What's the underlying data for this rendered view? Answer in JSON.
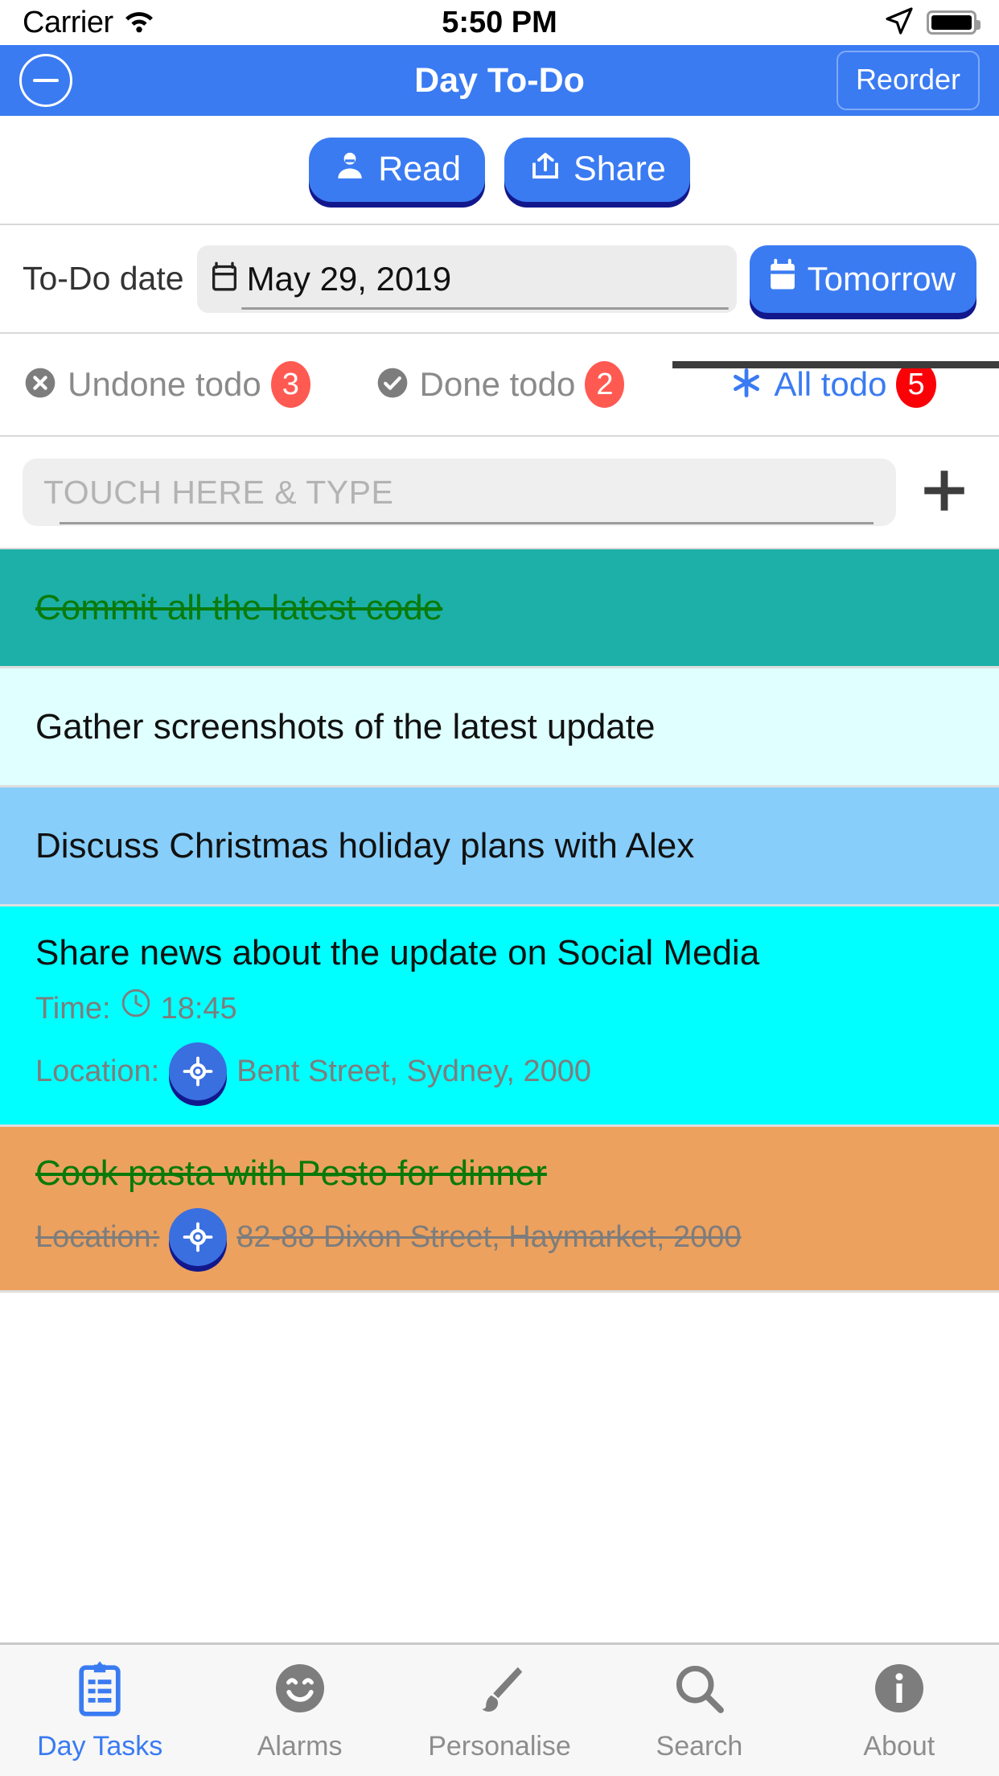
{
  "status_bar": {
    "carrier": "Carrier",
    "wifi_icon": "wifi-icon",
    "time": "5:50 PM",
    "location_icon": "location-arrow-icon",
    "battery_icon": "battery-full-icon"
  },
  "nav_bar": {
    "minus_icon": "minus-circle-icon",
    "title": "Day To-Do",
    "reorder_label": "Reorder"
  },
  "actions": {
    "read_label": "Read",
    "read_icon": "person-icon",
    "share_label": "Share",
    "share_icon": "share-export-icon"
  },
  "date_row": {
    "label": "To-Do date",
    "calendar_icon": "calendar-icon",
    "value": "May 29, 2019",
    "tomorrow_label": "Tomorrow",
    "tomorrow_icon": "calendar-icon"
  },
  "filters": [
    {
      "label": "Undone todo",
      "count": "3",
      "icon": "x-circle-icon",
      "active": false
    },
    {
      "label": "Done todo",
      "count": "2",
      "icon": "check-circle-icon",
      "active": false
    },
    {
      "label": "All todo",
      "count": "5",
      "icon": "asterisk-icon",
      "active": true
    }
  ],
  "add_row": {
    "placeholder": "TOUCH HERE & TYPE",
    "value": "",
    "plus_icon": "plus-icon"
  },
  "tasks": [
    {
      "title": "Commit all the latest code",
      "done": true,
      "color": "#1cb0a8",
      "time": "",
      "location": ""
    },
    {
      "title": "Gather screenshots of the latest update",
      "done": false,
      "color": "#e0ffff",
      "time": "",
      "location": ""
    },
    {
      "title": "Discuss Christmas holiday plans with Alex",
      "done": false,
      "color": "#87cefa",
      "time": "",
      "location": ""
    },
    {
      "title": "Share news about the update on Social Media",
      "done": false,
      "color": "#00ffff",
      "time_label": "Time:",
      "time": "18:45",
      "location_label": "Location:",
      "location": "Bent Street, Sydney, 2000"
    },
    {
      "title": "Cook pasta with Pesto for dinner",
      "done": true,
      "color": "#eda15e",
      "time": "",
      "location_label": "Location:",
      "location": "82-88 Dixon Street, Haymarket, 2000"
    }
  ],
  "tab_bar": [
    {
      "label": "Day Tasks",
      "icon": "clipboard-icon",
      "active": true
    },
    {
      "label": "Alarms",
      "icon": "smiley-icon",
      "active": false
    },
    {
      "label": "Personalise",
      "icon": "brush-icon",
      "active": false
    },
    {
      "label": "Search",
      "icon": "search-icon",
      "active": false
    },
    {
      "label": "About",
      "icon": "info-icon",
      "active": false
    }
  ],
  "colors": {
    "accent": "#3a7bf2",
    "badge": "#ff5a52",
    "badge_active": "#fb0007",
    "done_text": "#0a7a0a"
  }
}
